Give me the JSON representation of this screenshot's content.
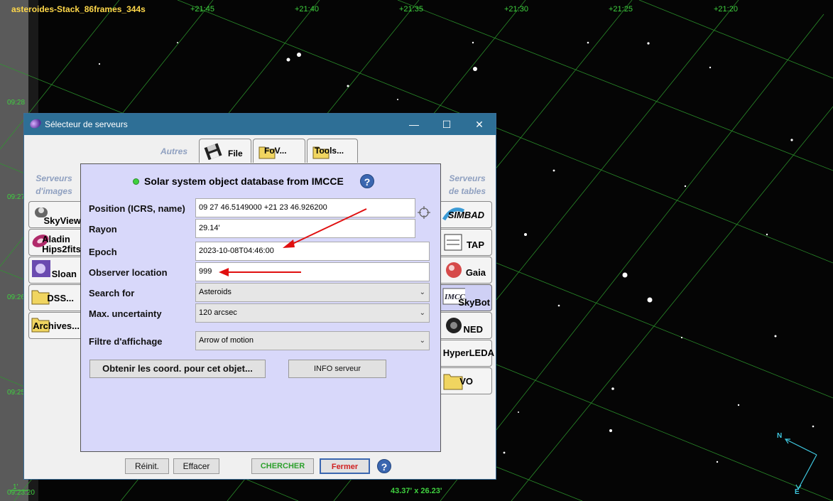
{
  "image": {
    "title": "asteroides-Stack_86frames_344s",
    "ra_labels": [
      "+21:45",
      "+21:40",
      "+21:35",
      "+21:30",
      "+21:25",
      "+21:20"
    ],
    "dec_labels": [
      "09:28",
      "09:27",
      "09:26",
      "09:25",
      "09:23:20"
    ],
    "fov": "43.37' x 26.23'",
    "scale": "1'",
    "compass_north": "N",
    "compass_east": "E"
  },
  "dialog": {
    "title": "Sélecteur de serveurs",
    "window_buttons": {
      "minimize": "—",
      "maximize": "☐",
      "close": "✕"
    },
    "autres_label": "Autres",
    "top_tabs": [
      "File",
      "FoV...",
      "Tools..."
    ],
    "image_servers_heading": "Serveurs\nd'images",
    "table_servers_heading": "Serveurs\nde tables",
    "image_servers": [
      "SkyView",
      "Aladin\nHips2fits",
      "Sloan",
      "DSS...",
      "Archives..."
    ],
    "table_servers": [
      "SIMBAD",
      "TAP",
      "Gaia",
      "SkyBot",
      "NED",
      "HyperLEDA",
      "VO"
    ],
    "active_table_server": "SkyBot",
    "form": {
      "title": "Solar system object database from IMCCE",
      "help": "?",
      "position_label": "Position (ICRS, name)",
      "position_value": "09 27 46.5149000 +21 23 46.926200",
      "radius_label": "Rayon",
      "radius_value": "29.14'",
      "epoch_label": "Epoch",
      "epoch_value": "2023-10-08T04:46:00",
      "observer_label": "Observer location",
      "observer_value": "999",
      "search_for_label": "Search for",
      "search_for_value": "Asteroids",
      "uncertainty_label": "Max. uncertainty",
      "uncertainty_value": "120 arcsec",
      "filter_label": "Filtre d'affichage",
      "filter_value": "Arrow of motion",
      "get_coords_button": "Obtenir les coord. pour cet objet...",
      "info_button": "INFO serveur"
    },
    "bottom": {
      "reset": "Réinit.",
      "clear": "Effacer",
      "search": "CHERCHER",
      "close": "Fermer",
      "help": "?"
    },
    "colors": {
      "search_text": "#2ca02c",
      "close_text": "#d02020",
      "panel_bg": "#d8d8fa",
      "titlebar": "#2e6f96",
      "arrow": "#e01010"
    }
  }
}
